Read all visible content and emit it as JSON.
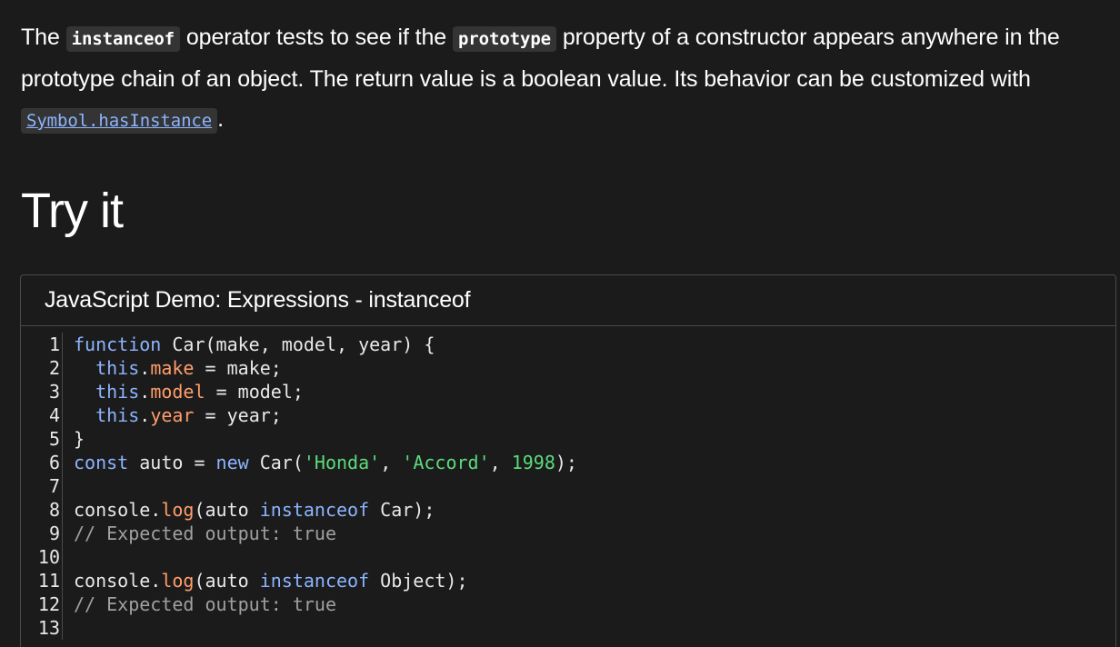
{
  "intro": {
    "t1": "The ",
    "code1": "instanceof",
    "t2": " operator tests to see if the ",
    "code2": "prototype",
    "t3": " property of a constructor appears anywhere in the prototype chain of an object. The return value is a boolean value. Its behavior can be customized with ",
    "link": "Symbol.hasInstance",
    "t4": "."
  },
  "section_title": "Try it",
  "demo": {
    "title": "JavaScript Demo: Expressions - instanceof",
    "line_numbers": [
      "1",
      "2",
      "3",
      "4",
      "5",
      "6",
      "7",
      "8",
      "9",
      "10",
      "11",
      "12",
      "13"
    ],
    "code": {
      "l1": {
        "kw": "function",
        "rest": " Car(make, model, year) {"
      },
      "l2": {
        "kw": "this",
        "dot": ".",
        "prop": "make",
        "rest": " = make;"
      },
      "l3": {
        "kw": "this",
        "dot": ".",
        "prop": "model",
        "rest": " = model;"
      },
      "l4": {
        "kw": "this",
        "dot": ".",
        "prop": "year",
        "rest": " = year;"
      },
      "l5": {
        "rest": "}"
      },
      "l6": {
        "kw": "const",
        "a": " auto = ",
        "kw2": "new",
        "b": " Car(",
        "s1": "'Honda'",
        "c": ", ",
        "s2": "'Accord'",
        "d": ", ",
        "n": "1998",
        "e": ");"
      },
      "l8": {
        "a": "console.",
        "prop": "log",
        "b": "(auto ",
        "kw": "instanceof",
        "c": " Car);"
      },
      "l9": {
        "cmt": "// Expected output: true"
      },
      "l11": {
        "a": "console.",
        "prop": "log",
        "b": "(auto ",
        "kw": "instanceof",
        "c": " Object);"
      },
      "l12": {
        "cmt": "// Expected output: true"
      }
    }
  },
  "colors": {
    "background": "#1b1b1b",
    "keyword": "#8cb4ff",
    "property": "#ff9d6b",
    "string": "#5cdb7b",
    "comment": "#a0a0a0",
    "link": "#8cb4ff"
  }
}
